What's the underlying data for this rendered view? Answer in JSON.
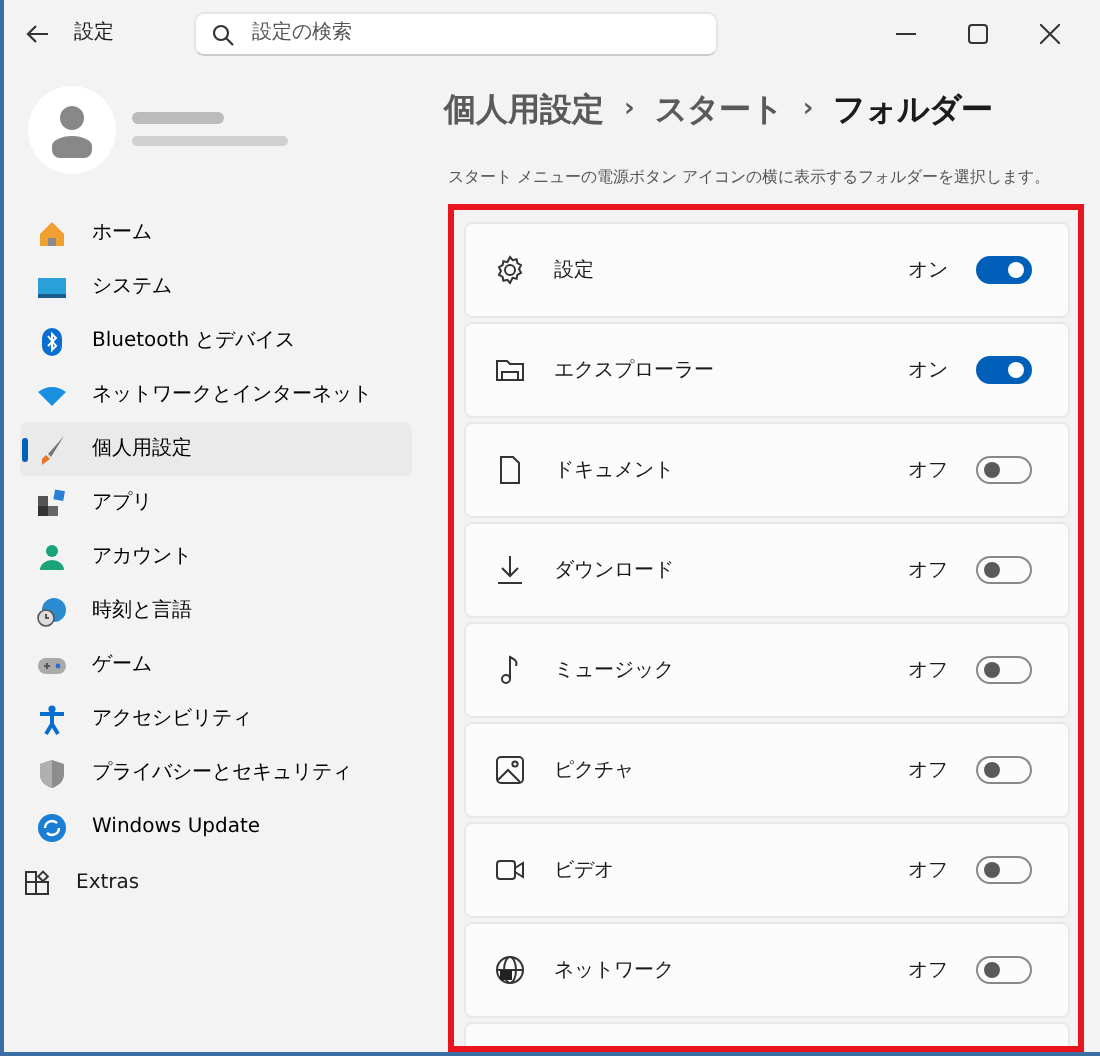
{
  "window": {
    "title": "設定"
  },
  "search": {
    "placeholder": "設定の検索"
  },
  "sidebar": {
    "items": [
      {
        "label": "ホーム",
        "selected": false
      },
      {
        "label": "システム",
        "selected": false
      },
      {
        "label": "Bluetooth とデバイス",
        "selected": false
      },
      {
        "label": "ネットワークとインターネット",
        "selected": false
      },
      {
        "label": "個人用設定",
        "selected": true
      },
      {
        "label": "アプリ",
        "selected": false
      },
      {
        "label": "アカウント",
        "selected": false
      },
      {
        "label": "時刻と言語",
        "selected": false
      },
      {
        "label": "ゲーム",
        "selected": false
      },
      {
        "label": "アクセシビリティ",
        "selected": false
      },
      {
        "label": "プライバシーとセキュリティ",
        "selected": false
      },
      {
        "label": "Windows Update",
        "selected": false
      }
    ],
    "extras": "Extras"
  },
  "breadcrumb": [
    {
      "label": "個人用設定",
      "current": false
    },
    {
      "label": "›",
      "current": false
    },
    {
      "label": "スタート",
      "current": false
    },
    {
      "label": "›",
      "current": false
    },
    {
      "label": "フォルダー",
      "current": true
    }
  ],
  "description": "スタート メニューの電源ボタン アイコンの横に表示するフォルダーを選択します。",
  "folders": {
    "highlighted": true,
    "items": [
      {
        "label": "設定",
        "state": "オン",
        "on": true
      },
      {
        "label": "エクスプローラー",
        "state": "オン",
        "on": true
      },
      {
        "label": "ドキュメント",
        "state": "オフ",
        "on": false
      },
      {
        "label": "ダウンロード",
        "state": "オフ",
        "on": false
      },
      {
        "label": "ミュージック",
        "state": "オフ",
        "on": false
      },
      {
        "label": "ピクチャ",
        "state": "オフ",
        "on": false
      },
      {
        "label": "ビデオ",
        "state": "オフ",
        "on": false
      },
      {
        "label": "ネットワーク",
        "state": "オフ",
        "on": false
      }
    ]
  }
}
